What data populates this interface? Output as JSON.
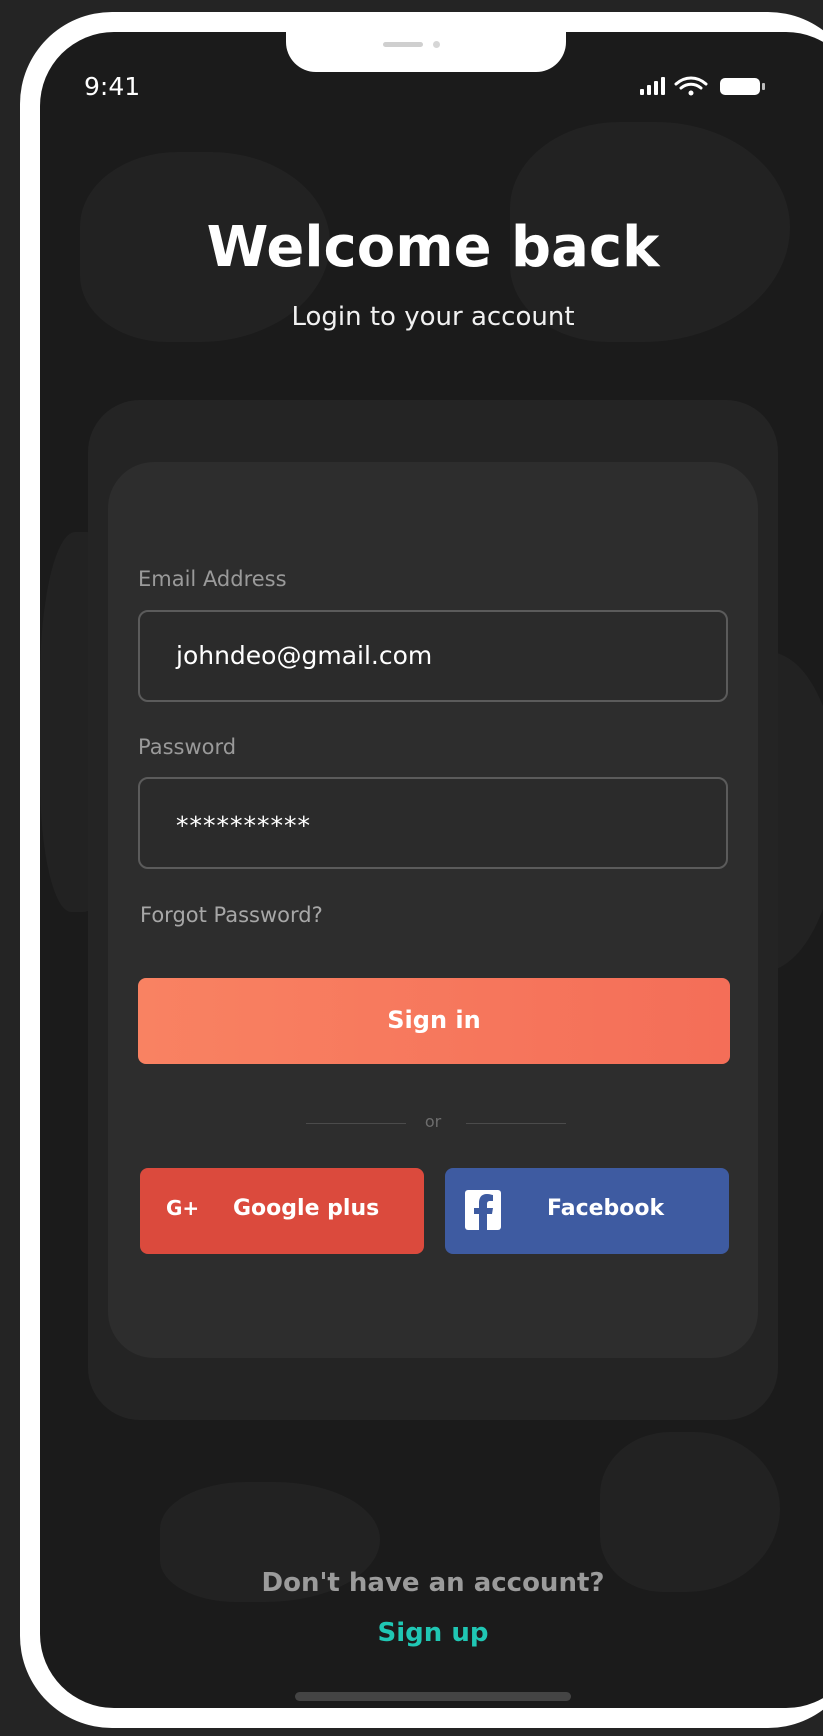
{
  "status_bar": {
    "time": "9:41",
    "signal_icon": "signal-bars-icon",
    "wifi_icon": "wifi-icon",
    "battery_icon": "battery-icon"
  },
  "header": {
    "title": "Welcome back",
    "subtitle": "Login to your account"
  },
  "form": {
    "email_label": "Email Address",
    "email_value": "johndeo@gmail.com",
    "password_label": "Password",
    "password_value": "**********",
    "forgot_password": "Forgot Password?",
    "sign_in_label": "Sign in",
    "divider_text": "or"
  },
  "social": {
    "google_icon_text": "G+",
    "google_label": "Google plus",
    "facebook_icon": "facebook-icon",
    "facebook_label": "Facebook"
  },
  "footer": {
    "question": "Don't have an account?",
    "signup_label": "Sign up"
  },
  "colors": {
    "primary_button": "#f46e58",
    "google_button": "#db4a3d",
    "facebook_button": "#3e5ba1",
    "signup_link": "#20c7b4",
    "background": "#1b1b1b",
    "card": "#2d2d2d"
  }
}
